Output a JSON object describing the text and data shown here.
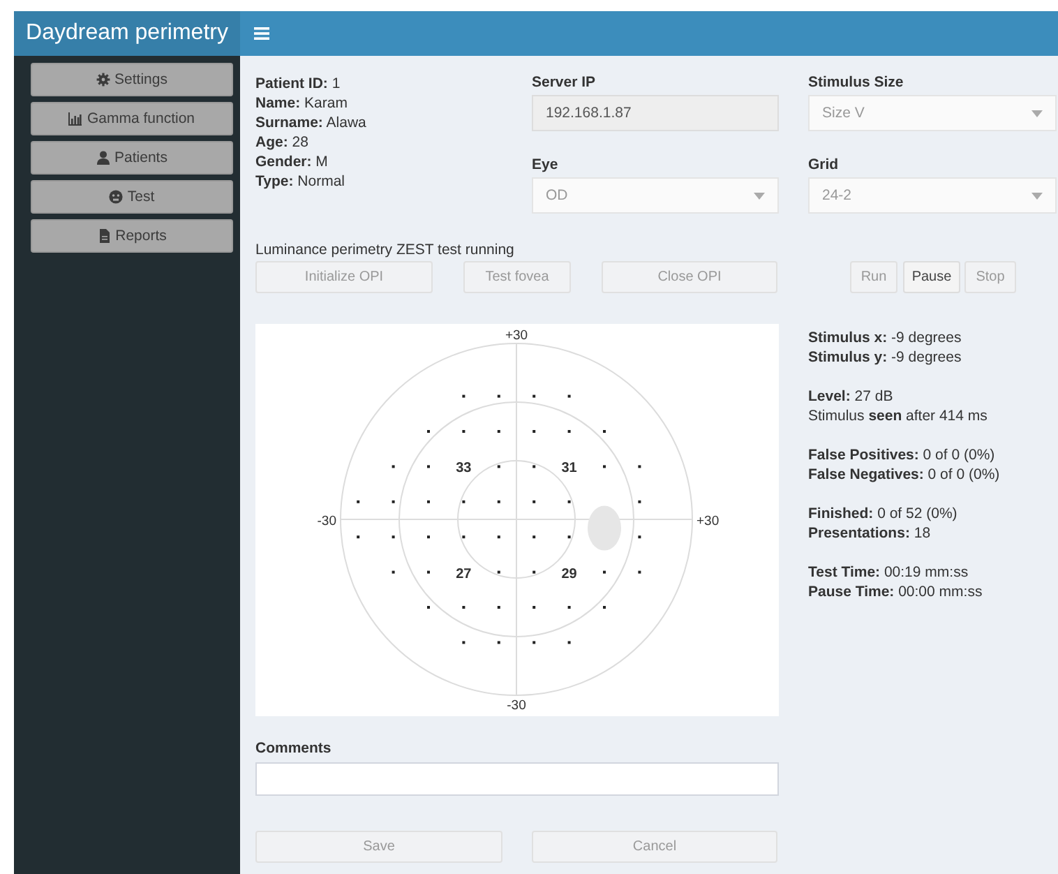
{
  "header": {
    "title": "Daydream perimetry"
  },
  "sidebar": {
    "items": [
      {
        "label": "Settings"
      },
      {
        "label": "Gamma function"
      },
      {
        "label": "Patients"
      },
      {
        "label": "Test"
      },
      {
        "label": "Reports"
      }
    ]
  },
  "patient": [
    "**Patient ID:** 1",
    "**Name:** Karam",
    "**Surname:** Alawa",
    "**Age:** 28",
    "**Gender:** M",
    "**Type:** Normal"
  ],
  "fields": [
    {
      "label": "Server IP",
      "kind": "text",
      "value": "192.168.1.87",
      "disabled": true
    },
    {
      "label": "Stimulus Size",
      "kind": "select",
      "value": "Size V",
      "disabled": true
    },
    {
      "label": "Eye",
      "kind": "select",
      "value": "OD",
      "disabled": true
    },
    {
      "label": "Grid",
      "kind": "select",
      "value": "24-2",
      "disabled": true
    }
  ],
  "status_text": "Luminance perimetry ZEST test running",
  "opi_buttons": [
    {
      "label": "Initialize OPI",
      "disabled": true
    },
    {
      "label": "Test fovea",
      "disabled": true
    },
    {
      "label": "Close OPI",
      "disabled": true
    }
  ],
  "run_buttons": [
    {
      "label": "Run",
      "disabled": true
    },
    {
      "label": "Pause",
      "disabled": false
    },
    {
      "label": "Stop",
      "disabled": true
    }
  ],
  "field_plot": {
    "axis_labels": [
      "+30",
      "-30",
      "+30",
      "-30"
    ],
    "thresholds": [
      "33",
      "31",
      "27",
      "29"
    ]
  },
  "stats": [
    [
      "**Stimulus x:** -9 degrees",
      "**Stimulus y:** -9 degrees"
    ],
    [
      "**Level:** 27 dB",
      "Stimulus **seen** after 414 ms"
    ],
    [
      "**False Positives:** 0 of 0 (0%)",
      "**False Negatives:** 0 of 0 (0%)"
    ],
    [
      "**Finished:** 0 of 52 (0%)",
      "**Presentations:** 18"
    ],
    [
      "**Test Time:** 00:19 mm:ss",
      "**Pause Time:** 00:00 mm:ss"
    ]
  ],
  "comments": {
    "label": "Comments"
  },
  "footer_buttons": [
    {
      "label": "Save",
      "disabled": true
    },
    {
      "label": "Cancel",
      "disabled": true
    }
  ]
}
